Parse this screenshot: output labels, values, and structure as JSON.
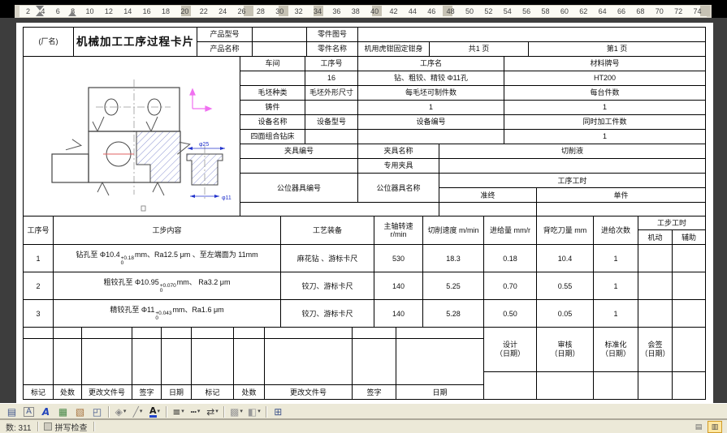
{
  "ruler": {
    "numbers": [
      "2",
      "4",
      "6",
      "8",
      "10",
      "12",
      "14",
      "16",
      "18",
      "20",
      "22",
      "24",
      "26",
      "28",
      "30",
      "32",
      "34",
      "36",
      "38",
      "40",
      "42",
      "44",
      "46",
      "48",
      "50",
      "52",
      "54",
      "56",
      "58",
      "60",
      "62",
      "64",
      "66",
      "68",
      "70",
      "72",
      "74"
    ]
  },
  "header": {
    "factory": "(厂名)",
    "title": "机械加工工序过程卡片",
    "product_model_label": "产品型号",
    "product_name_label": "产品名称",
    "part_no_label": "零件图号",
    "part_name_label": "零件名称",
    "part_name_value": "机用虎钳固定钳身",
    "total_pages": "共1 页",
    "page_no": "第1 页"
  },
  "info": {
    "labels": {
      "workshop": "车间",
      "op_no": "工序号",
      "op_name": "工序名",
      "material": "材料牌号",
      "blank_type": "毛坯种类",
      "blank_size": "毛坯外形尺寸",
      "blank_per": "每毛坯可制件数",
      "per_unit": "每台件数",
      "equip_name": "设备名称",
      "equip_model": "设备型号",
      "equip_no": "设备编号",
      "simul": "同时加工件数",
      "fixture_no": "夹具编号",
      "fixture_name": "夹具名称",
      "coolant": "切削液",
      "special_fixture": "专用夹具",
      "tooling_no": "公位器具编号",
      "tooling_name": "公位器具名称",
      "op_time": "工序工时",
      "prep_time": "准终",
      "unit_time": "单件"
    },
    "values": {
      "op_no": "16",
      "op_name": "钻、粗铰、精铰 Φ11孔",
      "material": "HT200",
      "blank_type": "铸件",
      "blank_per": "1",
      "per_unit": "1",
      "equip_name": "四面组合钻床",
      "simul": "1"
    }
  },
  "steps": {
    "headers": {
      "no": "工序号",
      "content": "工步内容",
      "tooling": "工艺装备",
      "spindle_line1": "主轴转速",
      "spindle_line2": "r/min",
      "cut_speed": "切削速度 m/min",
      "feed": "进给量 mm/r",
      "depth": "背吃刀量 mm",
      "passes": "进给次数",
      "step_time": "工步工时",
      "machine": "机动",
      "aux": "辅助"
    },
    "rows": [
      {
        "no": "1",
        "prefix": "钻孔至 Φ10.4",
        "tol_up": "+0.18",
        "tol_dn": "0",
        "suffix": "mm、Ra12.5 μm 、至左端面为 11mm",
        "tools": "麻花钻 、游标卡尺",
        "spindle": "530",
        "cut_speed": "18.3",
        "feed": "0.18",
        "depth": "10.4",
        "passes": "1",
        "machine": "",
        "aux": ""
      },
      {
        "no": "2",
        "prefix": "粗铰孔至 Φ10.95",
        "tol_up": "+0.070",
        "tol_dn": "0",
        "suffix": "mm、 Ra3.2 μm",
        "tools": "铰刀、游标卡尺",
        "spindle": "140",
        "cut_speed": "5.25",
        "feed": "0.70",
        "depth": "0.55",
        "passes": "1",
        "machine": "",
        "aux": ""
      },
      {
        "no": "3",
        "prefix": "精铰孔至 Φ11",
        "tol_up": "+0.043",
        "tol_dn": "0",
        "suffix": "mm、Ra1.6 μm",
        "tools": "铰刀、游标卡尺",
        "spindle": "140",
        "cut_speed": "5.28",
        "feed": "0.50",
        "depth": "0.05",
        "passes": "1",
        "machine": "",
        "aux": ""
      }
    ]
  },
  "bottom": {
    "sign": [
      {
        "name": "设计",
        "date": "（日期）"
      },
      {
        "name": "审核",
        "date": "（日期）"
      },
      {
        "name": "标准化",
        "date": "（日期）"
      },
      {
        "name": "会签",
        "date": "（日期）"
      }
    ],
    "change_labels": [
      "标记",
      "处数",
      "更改文件号",
      "签字",
      "日期",
      "标记",
      "处数",
      "更改文件号",
      "签字",
      "日期"
    ]
  },
  "drawing": {
    "dim_top": "φ25",
    "dim_bottom": "φ11"
  },
  "toolbar": {
    "icons": [
      {
        "name": "text-wrap-frame-icon",
        "glyph": "▤",
        "color": "#44598e"
      },
      {
        "name": "frame-text-icon",
        "glyph": "A",
        "color": "#44598e",
        "frame": true
      },
      {
        "name": "insert-wordart-icon",
        "glyph": "A",
        "color": "#2244bb",
        "italic": true
      },
      {
        "name": "insert-picture-icon",
        "glyph": "▦",
        "color": "#4a8a4a"
      },
      {
        "name": "insert-clipart-icon",
        "glyph": "▧",
        "color": "#a5713d"
      },
      {
        "name": "insert-textbox-icon",
        "glyph": "◰",
        "color": "#44598e"
      },
      {
        "sep": true
      },
      {
        "name": "fill-color-icon",
        "glyph": "◈",
        "color": "#8a8a8a",
        "arrow": true
      },
      {
        "name": "line-color-icon",
        "glyph": "╱",
        "color": "#8a8a8a",
        "arrow": true
      },
      {
        "name": "font-color-icon",
        "glyph": "A",
        "color": "#1a1a1a",
        "bar": "#2244cc",
        "arrow": true
      },
      {
        "sep": true
      },
      {
        "name": "line-style-icon",
        "glyph": "≡",
        "color": "#1a1a1a",
        "arrow": true
      },
      {
        "name": "dash-style-icon",
        "glyph": "┅",
        "color": "#444444",
        "arrow": true
      },
      {
        "name": "arrow-style-icon",
        "glyph": "⇄",
        "color": "#444444",
        "arrow": true
      },
      {
        "sep": true
      },
      {
        "name": "shadow-style-icon",
        "glyph": "▩",
        "color": "#999999",
        "arrow": true
      },
      {
        "name": "threed-style-icon",
        "glyph": "◧",
        "color": "#999999",
        "arrow": true
      },
      {
        "sep": true
      },
      {
        "name": "select-objects-icon",
        "glyph": "⊞",
        "color": "#44598e"
      }
    ]
  },
  "statusbar": {
    "word_count": "数: 311",
    "spell_check": "拼写检查"
  }
}
